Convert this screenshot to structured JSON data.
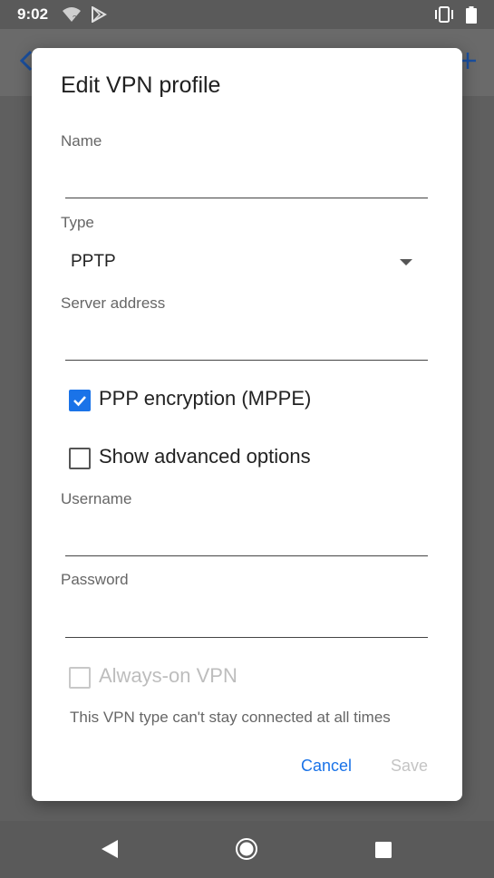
{
  "status_bar": {
    "time": "9:02",
    "icons": [
      "wifi-unknown-icon",
      "play-store-icon",
      "vibrate-icon",
      "battery-icon"
    ]
  },
  "background_app": {
    "icons": [
      "back-arrow-icon",
      "add-icon"
    ]
  },
  "dialog": {
    "title": "Edit VPN profile",
    "name": {
      "label": "Name",
      "value": ""
    },
    "type": {
      "label": "Type",
      "value": "PPTP"
    },
    "server_address": {
      "label": "Server address",
      "value": ""
    },
    "ppp_encryption": {
      "label": "PPP encryption (MPPE)",
      "checked": true
    },
    "show_advanced": {
      "label": "Show advanced options",
      "checked": false
    },
    "username": {
      "label": "Username",
      "value": ""
    },
    "password": {
      "label": "Password",
      "value": ""
    },
    "always_on": {
      "label": "Always-on VPN",
      "checked": false,
      "enabled": false
    },
    "note": "This VPN type can't stay connected at all times",
    "cancel_label": "Cancel",
    "save_label": "Save"
  },
  "nav_bar": {
    "icons": [
      "back-icon",
      "home-icon",
      "recents-icon"
    ]
  },
  "colors": {
    "accent": "#1a73e8",
    "scrim": "#5f5f5f",
    "disabled": "#c4c4c4"
  }
}
